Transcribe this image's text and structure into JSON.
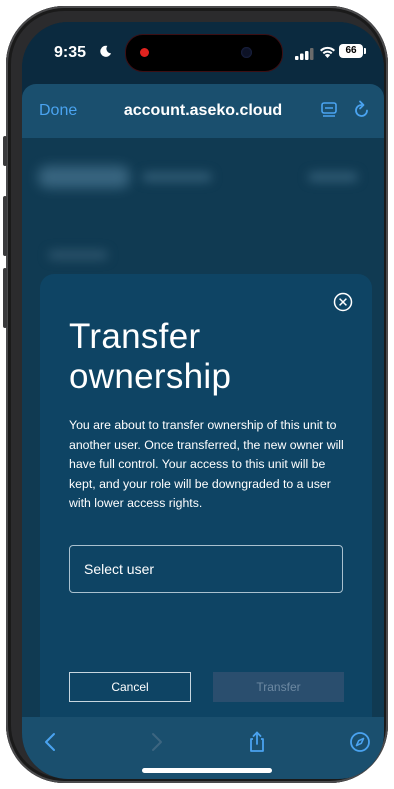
{
  "status": {
    "time": "9:35",
    "battery": "66"
  },
  "browser": {
    "done_label": "Done",
    "url": "account.aseko.cloud"
  },
  "modal": {
    "title": "Transfer ownership",
    "body": "You are about to transfer ownership of this unit to another user. Once transferred, the new owner will have full control. Your access to this unit will be kept, and your role will be downgraded to a user with lower access rights.",
    "select_placeholder": "Select user",
    "cancel_label": "Cancel",
    "transfer_label": "Transfer"
  },
  "colors": {
    "accent": "#4aa3f0",
    "modal_bg": "#0e4464",
    "toolbar_bg": "#1a4f6e",
    "disabled_button": "#2a4e6e"
  },
  "icons": {
    "back": "chevron-left-icon",
    "forward": "chevron-right-icon",
    "share": "share-icon",
    "safari": "compass-icon",
    "reader": "reader-icon",
    "reload": "reload-icon",
    "close": "close-circle-icon"
  }
}
